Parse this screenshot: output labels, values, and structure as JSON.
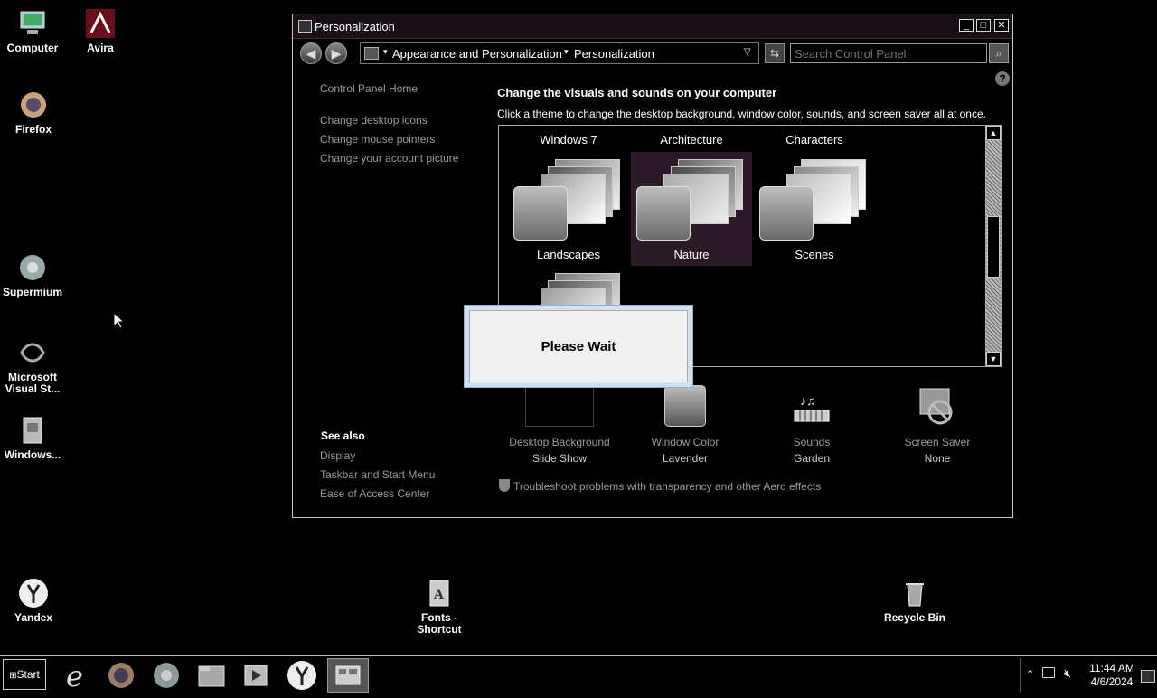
{
  "desktop": {
    "icons": [
      {
        "label": "Computer"
      },
      {
        "label": "Avira"
      },
      {
        "label": "Firefox"
      },
      {
        "label": "Supermium"
      },
      {
        "label": "Microsoft Visual St..."
      },
      {
        "label": "Windows..."
      },
      {
        "label": "Yandex"
      },
      {
        "label": "Fonts - Shortcut"
      },
      {
        "label": "Recycle Bin"
      }
    ]
  },
  "window": {
    "title": "Personalization",
    "breadcrumb": [
      "Appearance and Personalization",
      "Personalization"
    ],
    "search_placeholder": "Search Control Panel",
    "sidebar": {
      "home": "Control Panel Home",
      "links": [
        "Change desktop icons",
        "Change mouse pointers",
        "Change your account picture"
      ],
      "see_also_title": "See also",
      "see_also": [
        "Display",
        "Taskbar and Start Menu",
        "Ease of Access Center"
      ]
    },
    "heading": "Change the visuals and sounds on your computer",
    "subheading": "Click a theme to change the desktop background, window color, sounds, and screen saver all at once.",
    "theme_groups": [
      "Windows 7",
      "Architecture",
      "Characters"
    ],
    "themes": [
      {
        "name": "Landscapes",
        "selected": false
      },
      {
        "name": "Nature",
        "selected": true
      },
      {
        "name": "Scenes",
        "selected": false
      }
    ],
    "customize": [
      {
        "title": "Desktop Background",
        "value": "Slide Show",
        "icon": "desktop-background-icon"
      },
      {
        "title": "Window Color",
        "value": "Lavender",
        "icon": "window-color-icon"
      },
      {
        "title": "Sounds",
        "value": "Garden",
        "icon": "sounds-icon"
      },
      {
        "title": "Screen Saver",
        "value": "None",
        "icon": "screen-saver-icon"
      }
    ],
    "troubleshoot": "Troubleshoot problems with transparency and other Aero effects"
  },
  "dialog": {
    "text": "Please Wait"
  },
  "taskbar": {
    "start_label": "Start",
    "apps": [
      "internet-explorer-icon",
      "firefox-icon",
      "supermium-icon",
      "file-explorer-icon",
      "media-player-icon",
      "yandex-icon",
      "control-panel-icon"
    ],
    "time": "11:44 AM",
    "date": "4/6/2024"
  },
  "colors": {
    "window_title_bg": "#1a1118",
    "selected_theme_bg": "#2c1a26",
    "dialog_border": "#8fb1d6"
  }
}
